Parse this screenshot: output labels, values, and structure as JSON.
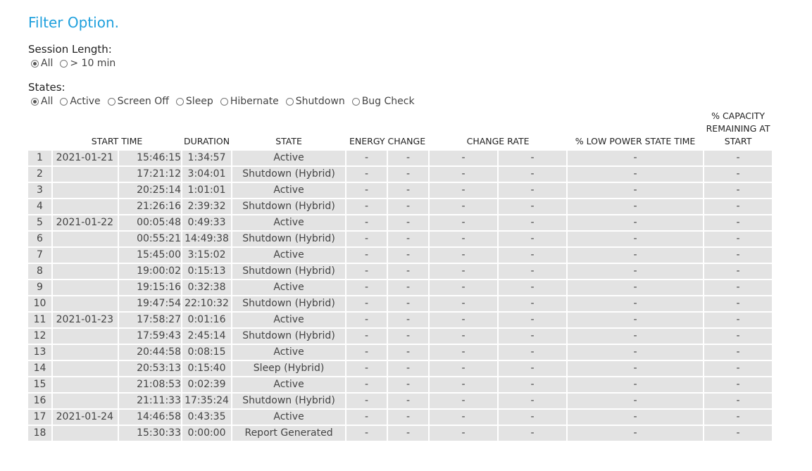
{
  "filter": {
    "title": "Filter Option.",
    "session_length": {
      "label": "Session Length:",
      "options": [
        {
          "label": "All",
          "checked": true
        },
        {
          "label": "> 10 min",
          "checked": false
        }
      ]
    },
    "states": {
      "label": "States:",
      "options": [
        {
          "label": "All",
          "checked": true
        },
        {
          "label": "Active",
          "checked": false
        },
        {
          "label": "Screen Off",
          "checked": false
        },
        {
          "label": "Sleep",
          "checked": false
        },
        {
          "label": "Hibernate",
          "checked": false
        },
        {
          "label": "Shutdown",
          "checked": false
        },
        {
          "label": "Bug Check",
          "checked": false
        }
      ]
    }
  },
  "table": {
    "headers": {
      "start_time": "START TIME",
      "duration": "DURATION",
      "state": "STATE",
      "energy_change": "ENERGY CHANGE",
      "change_rate": "CHANGE RATE",
      "low_power": "% LOW POWER STATE TIME",
      "capacity": "% CAPACITY REMAINING AT START"
    },
    "rows": [
      {
        "idx": "1",
        "date": "2021-01-21",
        "time": "15:46:15",
        "duration": "1:34:57",
        "state": "Active",
        "e1": "-",
        "e2": "-",
        "r1": "-",
        "r2": "-",
        "low": "-",
        "cap": "-"
      },
      {
        "idx": "2",
        "date": "",
        "time": "17:21:12",
        "duration": "3:04:01",
        "state": "Shutdown (Hybrid)",
        "e1": "-",
        "e2": "-",
        "r1": "-",
        "r2": "-",
        "low": "-",
        "cap": "-"
      },
      {
        "idx": "3",
        "date": "",
        "time": "20:25:14",
        "duration": "1:01:01",
        "state": "Active",
        "e1": "-",
        "e2": "-",
        "r1": "-",
        "r2": "-",
        "low": "-",
        "cap": "-"
      },
      {
        "idx": "4",
        "date": "",
        "time": "21:26:16",
        "duration": "2:39:32",
        "state": "Shutdown (Hybrid)",
        "e1": "-",
        "e2": "-",
        "r1": "-",
        "r2": "-",
        "low": "-",
        "cap": "-"
      },
      {
        "idx": "5",
        "date": "2021-01-22",
        "time": "00:05:48",
        "duration": "0:49:33",
        "state": "Active",
        "e1": "-",
        "e2": "-",
        "r1": "-",
        "r2": "-",
        "low": "-",
        "cap": "-"
      },
      {
        "idx": "6",
        "date": "",
        "time": "00:55:21",
        "duration": "14:49:38",
        "state": "Shutdown (Hybrid)",
        "e1": "-",
        "e2": "-",
        "r1": "-",
        "r2": "-",
        "low": "-",
        "cap": "-"
      },
      {
        "idx": "7",
        "date": "",
        "time": "15:45:00",
        "duration": "3:15:02",
        "state": "Active",
        "e1": "-",
        "e2": "-",
        "r1": "-",
        "r2": "-",
        "low": "-",
        "cap": "-"
      },
      {
        "idx": "8",
        "date": "",
        "time": "19:00:02",
        "duration": "0:15:13",
        "state": "Shutdown (Hybrid)",
        "e1": "-",
        "e2": "-",
        "r1": "-",
        "r2": "-",
        "low": "-",
        "cap": "-"
      },
      {
        "idx": "9",
        "date": "",
        "time": "19:15:16",
        "duration": "0:32:38",
        "state": "Active",
        "e1": "-",
        "e2": "-",
        "r1": "-",
        "r2": "-",
        "low": "-",
        "cap": "-"
      },
      {
        "idx": "10",
        "date": "",
        "time": "19:47:54",
        "duration": "22:10:32",
        "state": "Shutdown (Hybrid)",
        "e1": "-",
        "e2": "-",
        "r1": "-",
        "r2": "-",
        "low": "-",
        "cap": "-"
      },
      {
        "idx": "11",
        "date": "2021-01-23",
        "time": "17:58:27",
        "duration": "0:01:16",
        "state": "Active",
        "e1": "-",
        "e2": "-",
        "r1": "-",
        "r2": "-",
        "low": "-",
        "cap": "-"
      },
      {
        "idx": "12",
        "date": "",
        "time": "17:59:43",
        "duration": "2:45:14",
        "state": "Shutdown (Hybrid)",
        "e1": "-",
        "e2": "-",
        "r1": "-",
        "r2": "-",
        "low": "-",
        "cap": "-"
      },
      {
        "idx": "13",
        "date": "",
        "time": "20:44:58",
        "duration": "0:08:15",
        "state": "Active",
        "e1": "-",
        "e2": "-",
        "r1": "-",
        "r2": "-",
        "low": "-",
        "cap": "-"
      },
      {
        "idx": "14",
        "date": "",
        "time": "20:53:13",
        "duration": "0:15:40",
        "state": "Sleep (Hybrid)",
        "e1": "-",
        "e2": "-",
        "r1": "-",
        "r2": "-",
        "low": "-",
        "cap": "-"
      },
      {
        "idx": "15",
        "date": "",
        "time": "21:08:53",
        "duration": "0:02:39",
        "state": "Active",
        "e1": "-",
        "e2": "-",
        "r1": "-",
        "r2": "-",
        "low": "-",
        "cap": "-"
      },
      {
        "idx": "16",
        "date": "",
        "time": "21:11:33",
        "duration": "17:35:24",
        "state": "Shutdown (Hybrid)",
        "e1": "-",
        "e2": "-",
        "r1": "-",
        "r2": "-",
        "low": "-",
        "cap": "-"
      },
      {
        "idx": "17",
        "date": "2021-01-24",
        "time": "14:46:58",
        "duration": "0:43:35",
        "state": "Active",
        "e1": "-",
        "e2": "-",
        "r1": "-",
        "r2": "-",
        "low": "-",
        "cap": "-"
      },
      {
        "idx": "18",
        "date": "",
        "time": "15:30:33",
        "duration": "0:00:00",
        "state": "Report Generated",
        "e1": "-",
        "e2": "-",
        "r1": "-",
        "r2": "-",
        "low": "-",
        "cap": "-"
      }
    ]
  }
}
